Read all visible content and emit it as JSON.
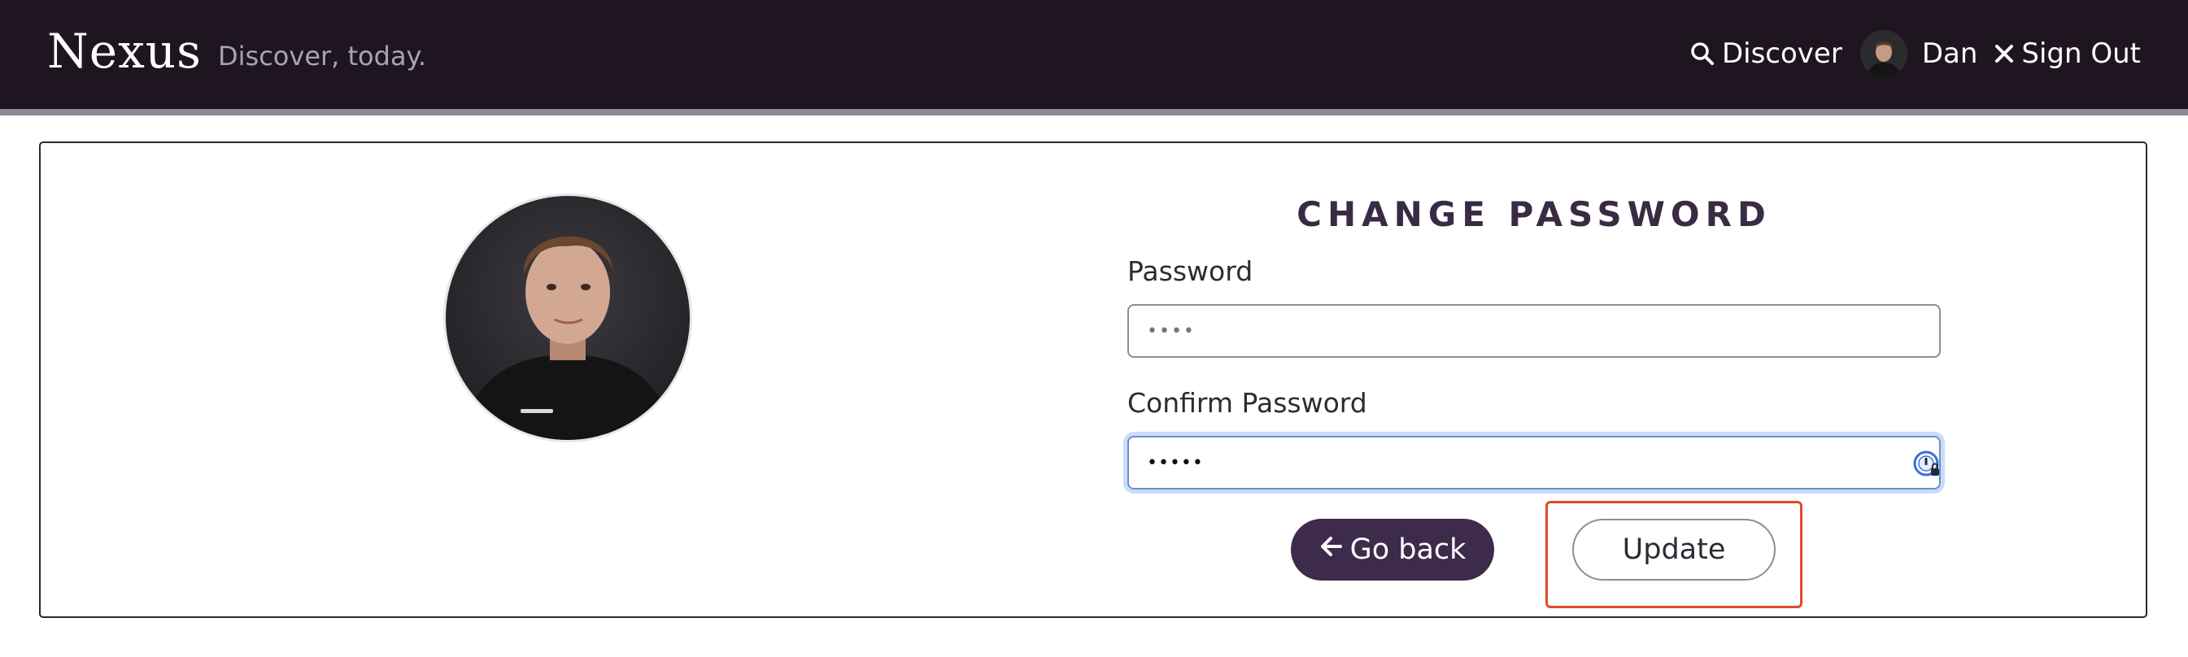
{
  "navbar": {
    "brand": "Nexus",
    "tagline": "Discover, today.",
    "discover_label": "Discover",
    "user_name": "Dan",
    "sign_out_label": "Sign Out"
  },
  "form": {
    "title": "CHANGE PASSWORD",
    "password_label": "Password",
    "password_placeholder": "••••",
    "confirm_label": "Confirm Password",
    "confirm_value": "•••••",
    "back_label": "Go back",
    "update_label": "Update"
  },
  "icons": {
    "discover": "search-icon",
    "sign_out": "close-icon",
    "back": "arrow-left-icon",
    "password_manager": "password-manager-icon"
  },
  "colors": {
    "navbar_bg": "#1f1520",
    "accent": "#3e2a4a",
    "focus_ring": "#c9dcfa",
    "highlight": "#e04a2a"
  }
}
